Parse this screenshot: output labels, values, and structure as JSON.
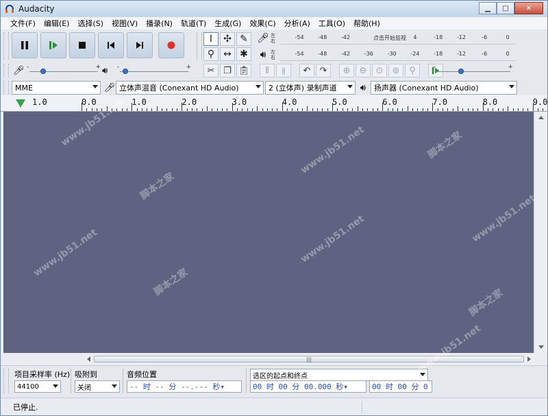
{
  "window": {
    "title": "Audacity",
    "minimize": "▁",
    "maximize": "□",
    "close": "✕"
  },
  "menu": [
    "文件(F)",
    "编辑(E)",
    "选择(S)",
    "视图(V)",
    "播录(N)",
    "轨道(T)",
    "生成(G)",
    "效果(C)",
    "分析(A)",
    "工具(O)",
    "帮助(H)"
  ],
  "meters": {
    "record_lr": [
      "左",
      "右"
    ],
    "play_lr": [
      "左",
      "右"
    ],
    "record_ticks": [
      "-54",
      "-48",
      "-42",
      "",
      "",
      "4",
      "-18",
      "-12",
      "-6",
      "0"
    ],
    "record_hint": "点击开始监视",
    "play_ticks": [
      "-54",
      "-48",
      "-42",
      "-36",
      "-30",
      "-24",
      "-18",
      "-12",
      "-6",
      "0"
    ]
  },
  "sliders": {
    "record_minus": "-",
    "record_plus": "+",
    "play_minus": "-",
    "play_plus": "+",
    "speed_minus": "-",
    "speed_plus": "+"
  },
  "devices": {
    "host": "MME",
    "input": "立体声混音 (Conexant HD Audio)",
    "channels": "2 (立体声) 录制声道",
    "output": "扬声器 (Conexant HD Audio)"
  },
  "ruler": {
    "labels": [
      "1.0",
      "0.0",
      "1.0",
      "2.0",
      "3.0",
      "4.0",
      "5.0",
      "6.0",
      "7.0",
      "8.0",
      "9.0"
    ]
  },
  "selection_bar": {
    "rate_label": "项目采样率 (Hz)",
    "rate_value": "44100",
    "snap_label": "吸附到",
    "snap_value": "关闭",
    "pos_label": "音频位置",
    "pos_value": "-- 时 -- 分 --.--- 秒▾",
    "sel_mode": "选区的起点和终点",
    "sel_start": "00 时 00 分 00.000 秒▾",
    "sel_end": "00 时 00 分 0"
  },
  "status": {
    "text": "已停止."
  },
  "colors": {
    "track_bg": "#5d6381",
    "record": "#e0302a",
    "play_green": "#3aa34a"
  },
  "watermarks": [
    "www.jb51.net",
    "脚本之家",
    "www.jb51.net",
    "脚本之家",
    "www.jb51.net",
    "www.jb51.net",
    "脚本之家",
    "www.jb51.net",
    "脚本之家",
    "www.jb51.net"
  ]
}
